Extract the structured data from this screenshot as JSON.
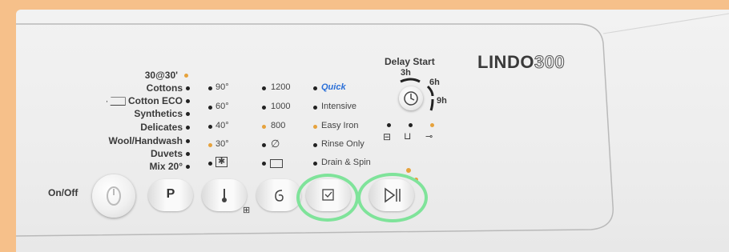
{
  "brand": {
    "name": "LINDO",
    "model_number": "300"
  },
  "delay_start": {
    "title": "Delay Start",
    "options": [
      "3h",
      "6h",
      "9h"
    ]
  },
  "programmes": [
    "30@30'",
    "Cottons",
    "Cotton ECO",
    "Synthetics",
    "Delicates",
    "Wool/Handwash",
    "Duvets",
    "Mix 20°"
  ],
  "temperatures": [
    "90°",
    "60°",
    "40°",
    "30°"
  ],
  "spin_speeds": [
    "1200",
    "1000",
    "800"
  ],
  "options": [
    "Quick",
    "Intensive",
    "Easy Iron",
    "Rinse Only",
    "Drain & Spin"
  ],
  "buttons": {
    "on_off": "On/Off",
    "programme": "P"
  },
  "colors": {
    "accent": "#e6a23c",
    "quick": "#2a6fd8",
    "highlight": "#7fe39a",
    "background": "#f6c08a"
  }
}
